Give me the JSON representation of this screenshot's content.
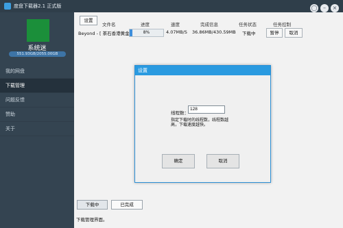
{
  "window": {
    "title": "度盘下载器2.1 正式版",
    "skin_icon": "shirt-icon",
    "min_icon": "minimize-icon",
    "close_icon": "close-icon"
  },
  "sidebar": {
    "username": "系统迷",
    "storage": "551.93GB/2055.00GB",
    "items": [
      {
        "label": "我的网盘",
        "active": false
      },
      {
        "label": "下载管理",
        "active": true
      },
      {
        "label": "问题反馈",
        "active": false
      },
      {
        "label": "赞助",
        "active": false
      },
      {
        "label": "关于",
        "active": false
      }
    ]
  },
  "toolbar": {
    "settings_label": "设置"
  },
  "table": {
    "headers": {
      "filename": "文件名",
      "progress": "进度",
      "speed": "速度",
      "complete": "完成信息",
      "status": "任务状态",
      "control": "任务控制"
    },
    "row": {
      "filename": "Beyond - [ 茶石香港黄金",
      "progress": "8%",
      "progress_value": 0.08,
      "speed": "4.07MB/S",
      "complete": "36.86MB/430.59MB",
      "status": "下载中",
      "pause_label": "暂停",
      "cancel_label": "取消"
    }
  },
  "dialog": {
    "title": "设置",
    "thread_label": "线程数：",
    "thread_value": "128",
    "hint": "指定下载时的线程数，线程数越高，下载速度越快。",
    "ok_label": "确定",
    "cancel_label": "取消"
  },
  "bottom": {
    "downloading_label": "下载中",
    "done_label": "已完成",
    "status_text": "下载管理界面。"
  },
  "colors": {
    "accent": "#2a9ae0",
    "sidebar_bg": "#344451",
    "avatar": "#1b8f3a"
  }
}
